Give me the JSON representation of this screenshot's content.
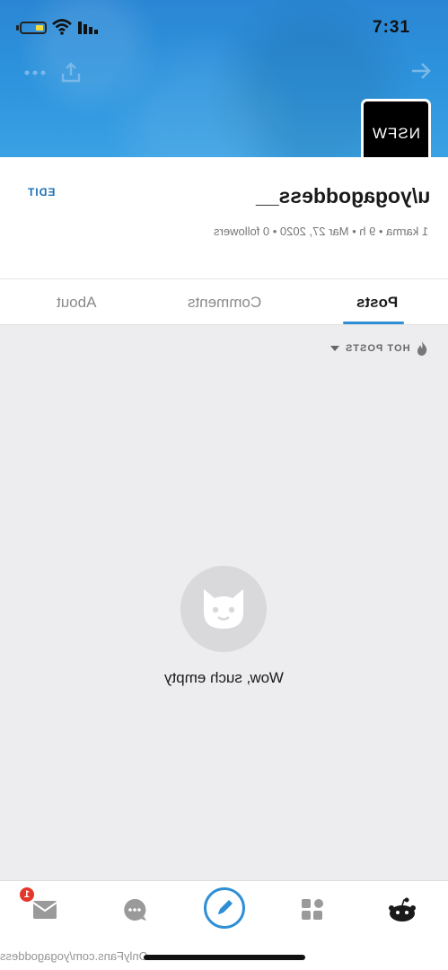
{
  "status_bar": {
    "time": "7:31",
    "battery_level": 0.25,
    "battery_color": "#f5dc3a"
  },
  "header": {
    "avatar_text": "NSFW",
    "back_icon": "arrow-back-icon",
    "share_icon": "share-icon",
    "more_icon": "more-icon"
  },
  "profile": {
    "username": "u/yogagoddess__",
    "edit_label": "EDIT",
    "meta": "1 karma • 9 h • Mar 27, 2020 • 0 followers"
  },
  "tabs": [
    {
      "label": "Posts",
      "active": true
    },
    {
      "label": "Comments",
      "active": false
    },
    {
      "label": "About",
      "active": false
    }
  ],
  "sort": {
    "label": "HOT POSTS",
    "icon": "flame-icon"
  },
  "empty_state": {
    "icon": "cat-icon",
    "text": "Wow, such empty"
  },
  "bottom_nav": {
    "items": [
      {
        "icon": "mail-icon",
        "badge": "1"
      },
      {
        "icon": "chat-icon"
      },
      {
        "icon": "pencil-icon"
      },
      {
        "icon": "grid-icon"
      },
      {
        "icon": "snoo-icon"
      }
    ]
  },
  "watermark": "OnlyFans.com/yogagoddess",
  "colors": {
    "accent": "#2e8fd6",
    "badge": "#e3372b",
    "background": "#ededef"
  }
}
